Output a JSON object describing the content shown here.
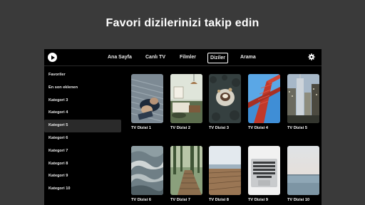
{
  "headline": "Favori dizilerinizi takip edin",
  "nav": {
    "items": [
      "Ana Sayfa",
      "Canlı TV",
      "Filmler",
      "Diziler",
      "Arama"
    ],
    "active_index": 3
  },
  "sidebar": {
    "items": [
      "Favoriler",
      "En son eklenen",
      "Kategori 3",
      "Kategori 4",
      "Kategori 5",
      "Kategori 6",
      "Kategori 7",
      "Kategori 8",
      "Kategori 9",
      "Kategori 10"
    ],
    "active_index": 4
  },
  "shows": [
    {
      "title": "TV Dizisi 1",
      "image": "hands-on-laptop-photo"
    },
    {
      "title": "TV Dizisi 2",
      "image": "room-interior-photo"
    },
    {
      "title": "TV Dizisi 3",
      "image": "coffee-cup-photo"
    },
    {
      "title": "TV Dizisi 4",
      "image": "red-bridge-photo"
    },
    {
      "title": "TV Dizisi 5",
      "image": "city-skyline-photo"
    },
    {
      "title": "TV Dizisi 6",
      "image": "ocean-waves-photo"
    },
    {
      "title": "TV Dizisi 7",
      "image": "forest-boardwalk-photo"
    },
    {
      "title": "TV Dizisi 8",
      "image": "wooden-pier-photo"
    },
    {
      "title": "TV Dizisi 9",
      "image": "laptop-keyboard-photo"
    },
    {
      "title": "TV Dizisi 10",
      "image": "sea-horizon-photo"
    }
  ],
  "colors": {
    "background": "#3a3a3a",
    "app_background": "#000000",
    "text": "#ffffff",
    "active_sidebar": "#2a2a2a"
  }
}
